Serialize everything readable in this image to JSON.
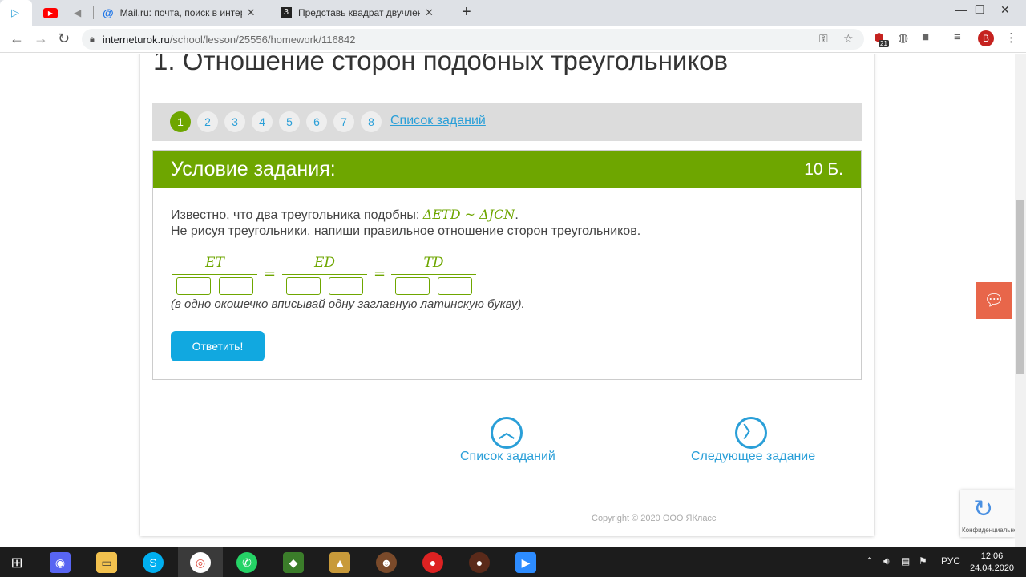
{
  "browser": {
    "tabs": [
      {
        "title": "",
        "icon": "play-icon"
      },
      {
        "title": "",
        "icon": "youtube-icon"
      },
      {
        "title": "",
        "icon": "muted-icon"
      },
      {
        "title": "Mail.ru: почта, поиск в интерне",
        "icon": "at-icon"
      },
      {
        "title": "Представь квадрат двучлена в",
        "icon": "znanija-icon"
      }
    ],
    "new_tab": "+",
    "url_host": "interneturok.ru",
    "url_path": "/school/lesson/25556/homework/116842",
    "badge_count": "21",
    "avatar_letter": "B"
  },
  "page": {
    "title": "1. Отношение сторон подобных треугольников",
    "pager": {
      "numbers": [
        "1",
        "2",
        "3",
        "4",
        "5",
        "6",
        "7",
        "8"
      ],
      "current": "1",
      "list_link": "Список заданий"
    },
    "task": {
      "header": "Условие задания:",
      "points": "10 Б.",
      "line1_text": "Известно, что два треугольника подобны: ",
      "line1_math": "ΔETD ~ ΔJCN",
      "line1_end": ".",
      "line2": "Не рисуя треугольники, напиши правильное отношение сторон треугольников.",
      "fractions": [
        "ET",
        "ED",
        "TD"
      ],
      "equals": "=",
      "hint": "(в одно окошечко вписывай одну заглавную латинскую букву).",
      "answer_button": "Ответить!"
    },
    "nav": {
      "list_label": "Список заданий",
      "next_label": "Следующее задание"
    },
    "copyright": "Copyright © 2020 ООО ЯКласс",
    "recaptcha_text": "Конфиденциально"
  },
  "taskbar": {
    "lang": "РУС",
    "time": "12:06",
    "date": "24.04.2020"
  },
  "colors": {
    "accent_green": "#6ea600",
    "link_blue": "#2a9fd8",
    "button_blue": "#11a8e0"
  }
}
